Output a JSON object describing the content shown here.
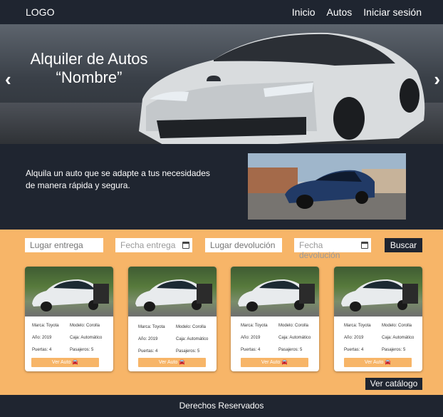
{
  "nav": {
    "logo": "LOGO",
    "links": [
      "Inicio",
      "Autos",
      "Iniciar sesión"
    ]
  },
  "hero": {
    "title_line1": "Alquiler de Autos",
    "title_line2": "“Nombre”",
    "prev_icon": "chevron-left-icon",
    "next_icon": "chevron-right-icon"
  },
  "intro": {
    "text": "Alquila un auto que se adapte a tus necesidades de manera rápida y segura."
  },
  "search": {
    "pickup_placeholder": "Lugar entrega",
    "pickup_date_placeholder": "Fecha entrega",
    "return_placeholder": "Lugar devolución",
    "return_date_placeholder": "Fecha devolución",
    "button": "Buscar"
  },
  "cards": [
    {
      "marca": "Marca: Toyota",
      "modelo": "Modelo: Corolla",
      "anio": "Año: 2019",
      "caja": "Caja: Automático",
      "puertas": "Puertas: 4",
      "pasajeros": "Pasajeros: 5",
      "button": "Ver Auto"
    },
    {
      "marca": "Marca: Toyota",
      "modelo": "Modelo: Corolla",
      "anio": "Año: 2019",
      "caja": "Caja: Automático",
      "puertas": "Puertas: 4",
      "pasajeros": "Pasajeros: 5",
      "button": "Ver Auto"
    },
    {
      "marca": "Marca: Toyota",
      "modelo": "Modelo: Corolla",
      "anio": "Año: 2019",
      "caja": "Caja: Automático",
      "puertas": "Puertas: 4",
      "pasajeros": "Pasajeros: 5",
      "button": "Ver Auto"
    },
    {
      "marca": "Marca: Toyota",
      "modelo": "Modelo: Corolla",
      "anio": "Año: 2019",
      "caja": "Caja: Automático",
      "puertas": "Puertas: 4",
      "pasajeros": "Pasajeros: 5",
      "button": "Ver Auto"
    }
  ],
  "catalog_button": "Ver catálogo",
  "footer": {
    "text": "Derechos Reservados"
  },
  "colors": {
    "dark": "#1f2530",
    "accent": "#f7b568",
    "white": "#ffffff"
  }
}
